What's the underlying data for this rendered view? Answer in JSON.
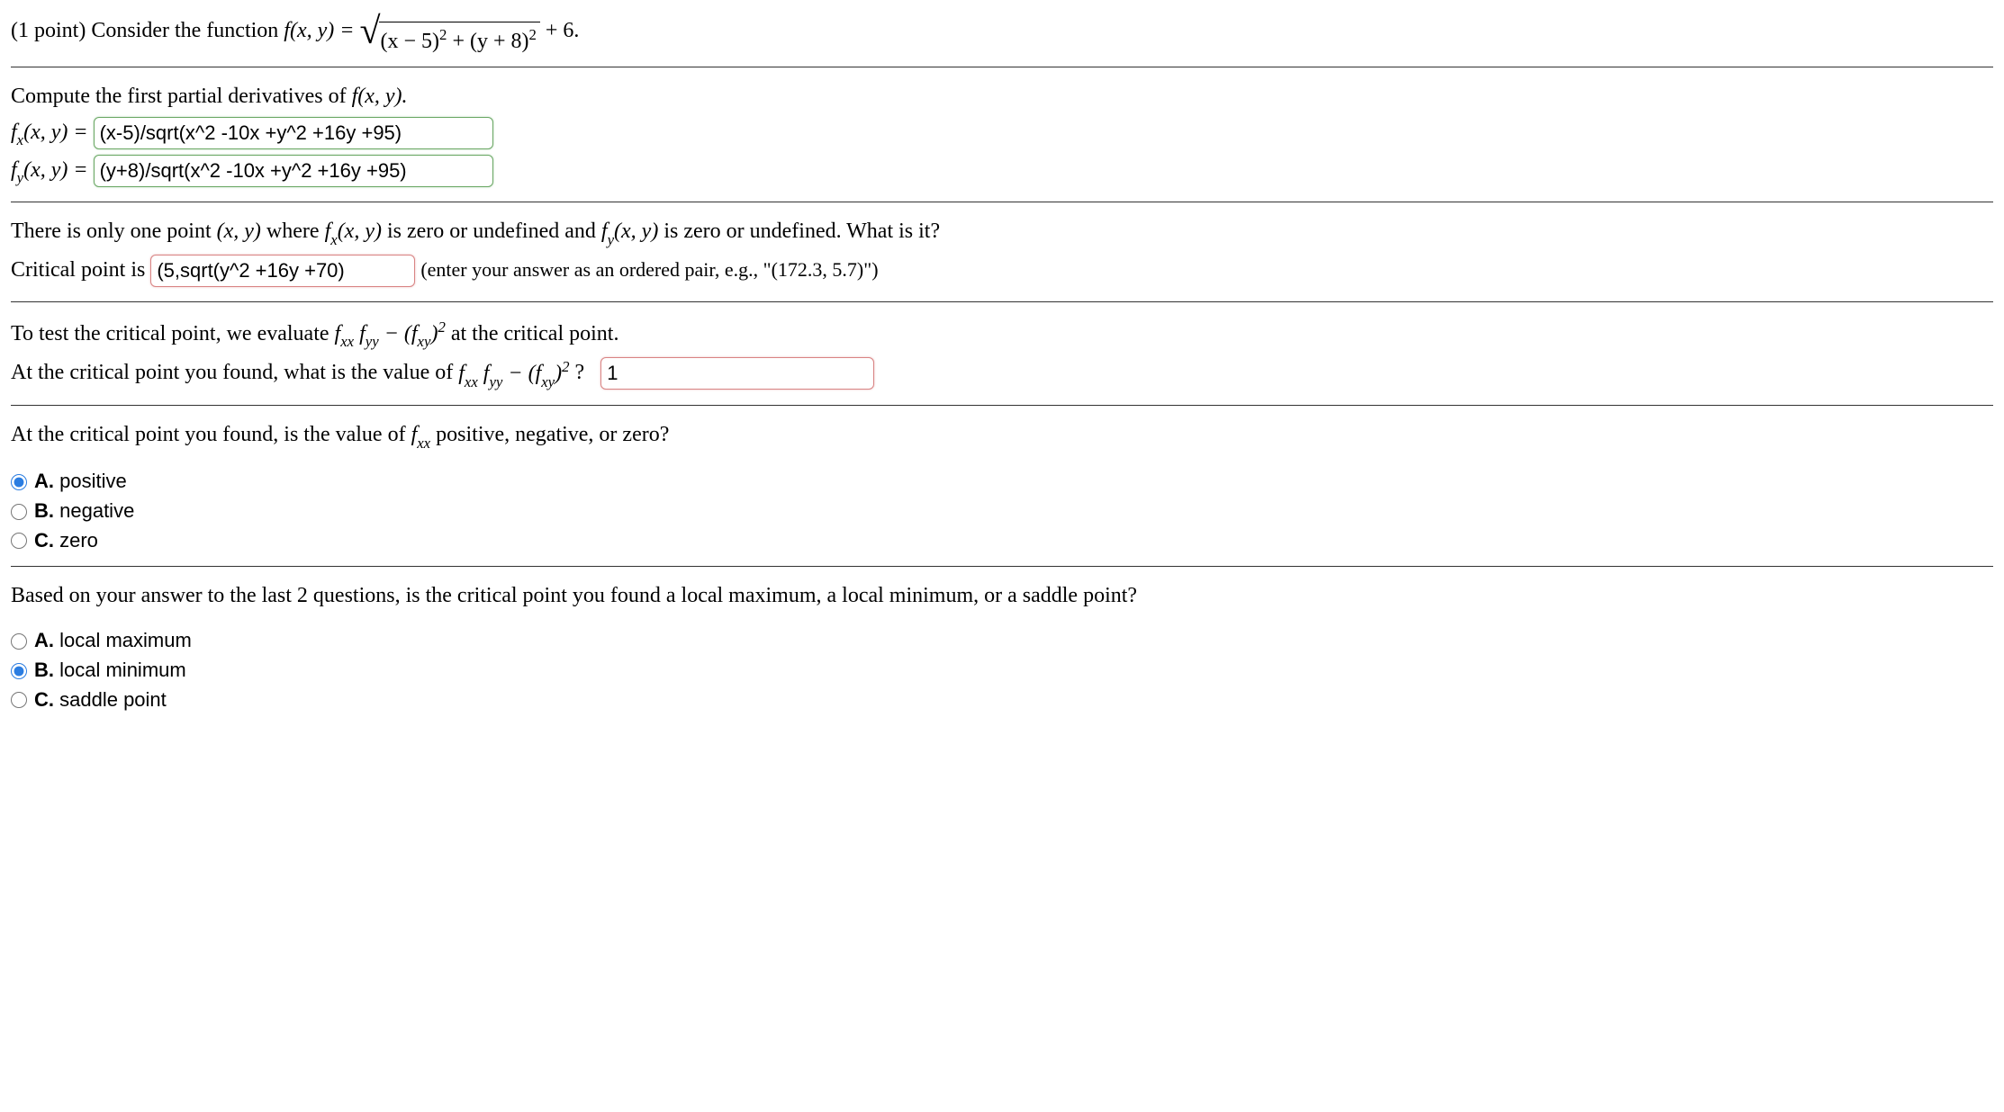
{
  "header": {
    "points": "(1 point)",
    "prompt_a": "Consider the function",
    "func_lhs": "f(x, y) =",
    "radicand": "(x − 5)",
    "radicand_exp1": "2",
    "radicand_mid": " + (y + 8)",
    "radicand_exp2": "2",
    "tail": " + 6."
  },
  "partials": {
    "prompt": "Compute the first partial derivatives of ",
    "fxy": "f(x, y).",
    "fx_label_a": "f",
    "fx_label_sub": "x",
    "fx_label_b": "(x, y) =",
    "fy_label_a": "f",
    "fy_label_sub": "y",
    "fy_label_b": "(x, y) =",
    "fx_value": "(x-5)/sqrt(x^2 -10x +y^2 +16y +95)",
    "fy_value": "(y+8)/sqrt(x^2 -10x +y^2 +16y +95)"
  },
  "critical": {
    "prompt_a": "There is only one point ",
    "xy": "(x, y)",
    "prompt_b": " where ",
    "fx": "f",
    "fx_sub": "x",
    "fx_args": "(x, y)",
    "prompt_c": " is zero or undefined and ",
    "fy": "f",
    "fy_sub": "y",
    "fy_args": "(x, y)",
    "prompt_d": " is zero or undefined. What is it?",
    "label": "Critical point is",
    "value": "(5,sqrt(y^2 +16y +70)",
    "hint": "(enter your answer as an ordered pair, e.g., \"(172.3, 5.7)\")"
  },
  "discriminant": {
    "prompt_a": "To test the critical point, we evaluate ",
    "expr_1": "f",
    "expr_1s": "xx",
    "expr_2": "f",
    "expr_2s": "yy",
    "minus": " − (",
    "expr_3": "f",
    "expr_3s": "xy",
    "close": ")",
    "sq": "2",
    "prompt_b": " at the critical point.",
    "line2_a": "At the critical point you found, what is the value of ",
    "line2_q": "?",
    "value": "1"
  },
  "fxx_sign": {
    "prompt_a": "At the critical point you found, is the value of ",
    "f": "f",
    "sub": "xx",
    "prompt_b": " positive, negative, or zero?",
    "options": {
      "a_letter": "A.",
      "a_text": "positive",
      "b_letter": "B.",
      "b_text": "negative",
      "c_letter": "C.",
      "c_text": "zero"
    },
    "selected": "A"
  },
  "classification": {
    "prompt": "Based on your answer to the last 2 questions, is the critical point you found a local maximum, a local minimum, or a saddle point?",
    "options": {
      "a_letter": "A.",
      "a_text": "local maximum",
      "b_letter": "B.",
      "b_text": "local minimum",
      "c_letter": "C.",
      "c_text": "saddle point"
    },
    "selected": "B"
  }
}
